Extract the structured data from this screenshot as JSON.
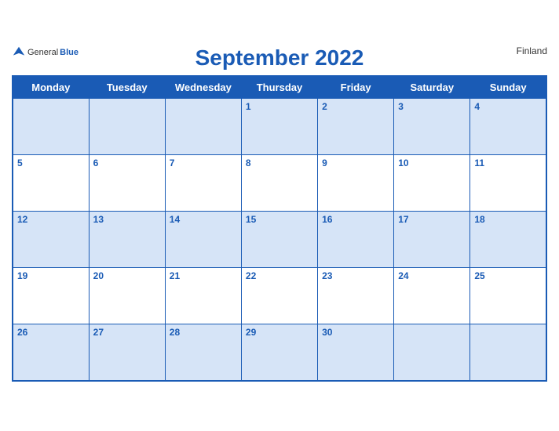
{
  "header": {
    "logo": {
      "general": "General",
      "blue": "Blue",
      "bird_unicode": "▲"
    },
    "title": "September 2022",
    "country": "Finland"
  },
  "weekdays": [
    "Monday",
    "Tuesday",
    "Wednesday",
    "Thursday",
    "Friday",
    "Saturday",
    "Sunday"
  ],
  "weeks": [
    [
      {
        "day": "",
        "empty": true
      },
      {
        "day": "",
        "empty": true
      },
      {
        "day": "",
        "empty": true
      },
      {
        "day": "1",
        "empty": false
      },
      {
        "day": "2",
        "empty": false
      },
      {
        "day": "3",
        "empty": false
      },
      {
        "day": "4",
        "empty": false
      }
    ],
    [
      {
        "day": "5",
        "empty": false
      },
      {
        "day": "6",
        "empty": false
      },
      {
        "day": "7",
        "empty": false
      },
      {
        "day": "8",
        "empty": false
      },
      {
        "day": "9",
        "empty": false
      },
      {
        "day": "10",
        "empty": false
      },
      {
        "day": "11",
        "empty": false
      }
    ],
    [
      {
        "day": "12",
        "empty": false
      },
      {
        "day": "13",
        "empty": false
      },
      {
        "day": "14",
        "empty": false
      },
      {
        "day": "15",
        "empty": false
      },
      {
        "day": "16",
        "empty": false
      },
      {
        "day": "17",
        "empty": false
      },
      {
        "day": "18",
        "empty": false
      }
    ],
    [
      {
        "day": "19",
        "empty": false
      },
      {
        "day": "20",
        "empty": false
      },
      {
        "day": "21",
        "empty": false
      },
      {
        "day": "22",
        "empty": false
      },
      {
        "day": "23",
        "empty": false
      },
      {
        "day": "24",
        "empty": false
      },
      {
        "day": "25",
        "empty": false
      }
    ],
    [
      {
        "day": "26",
        "empty": false
      },
      {
        "day": "27",
        "empty": false
      },
      {
        "day": "28",
        "empty": false
      },
      {
        "day": "29",
        "empty": false
      },
      {
        "day": "30",
        "empty": false
      },
      {
        "day": "",
        "empty": true
      },
      {
        "day": "",
        "empty": true
      }
    ]
  ]
}
